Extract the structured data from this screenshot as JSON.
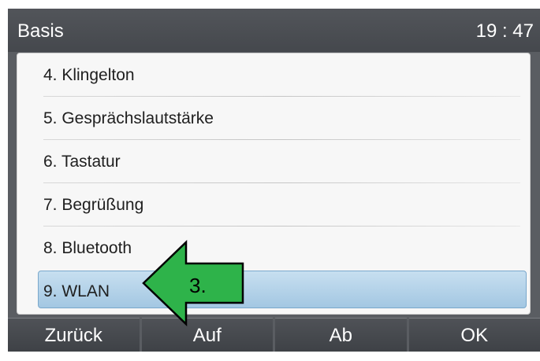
{
  "titlebar": {
    "title": "Basis",
    "clock": "19 : 47"
  },
  "menu": {
    "items": [
      {
        "label": "4. Klingelton"
      },
      {
        "label": "5. Gesprächslautstärke"
      },
      {
        "label": "6. Tastatur"
      },
      {
        "label": "7. Begrüßung"
      },
      {
        "label": "8. Bluetooth"
      },
      {
        "label": "9. WLAN",
        "selected": true
      }
    ]
  },
  "softkeys": [
    {
      "label": "Zurück"
    },
    {
      "label": "Auf"
    },
    {
      "label": "Ab"
    },
    {
      "label": "OK"
    }
  ],
  "annotation": {
    "step_label": "3.",
    "arrow_color": "#2eb34a"
  },
  "colors": {
    "titlebar": "#4b4e53",
    "selection": "#b7d5ec",
    "softkey": "#46494e"
  }
}
